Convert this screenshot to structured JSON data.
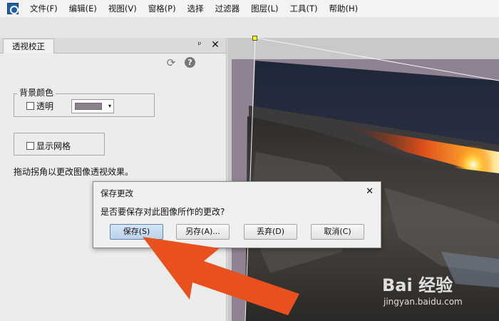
{
  "menu": {
    "items": [
      "文件(F)",
      "编辑(E)",
      "视图(V)",
      "窗格(P)",
      "选择",
      "过滤器",
      "图层(L)",
      "工具(T)",
      "帮助(H)"
    ]
  },
  "panel": {
    "tab_label": "透视校正",
    "pin_symbol": "ᵖ",
    "close_symbol": "✕",
    "refresh_symbol": "⟳",
    "help_symbol": "?",
    "background_group_title": "背景颜色",
    "transparent_label": "透明",
    "background_color": "#8e7f8c",
    "dropdown_arrow": "▾",
    "show_grid_label": "显示网格",
    "hint": "拖动拐角以更改图像透视效果。"
  },
  "dialog": {
    "title": "保存更改",
    "close_symbol": "✕",
    "message": "是否要保存对此图像所作的更改?",
    "buttons": {
      "save": "保存(S)",
      "save_as": "另存(A)...",
      "discard": "丢弃(D)",
      "cancel": "取消(C)"
    }
  },
  "watermark": {
    "text": "Bai 经验",
    "url": "jingyan.baidu.com"
  },
  "colors": {
    "accent_arrow": "#e8501e",
    "canvas_background": "#8f8292",
    "corner_handle": "#ffff00"
  }
}
